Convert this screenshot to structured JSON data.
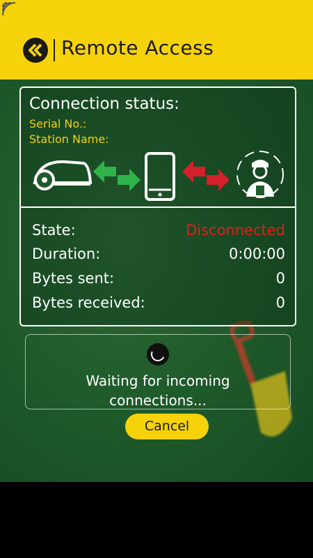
{
  "header": {
    "title": "Remote Access"
  },
  "status": {
    "heading": "Connection status:",
    "serial_label": "Serial No.:",
    "station_label": "Station Name:",
    "rows": [
      {
        "label": "State:",
        "value": "Disconnected"
      },
      {
        "label": "Duration:",
        "value": "0:00:00"
      },
      {
        "label": "Bytes sent:",
        "value": "0"
      },
      {
        "label": "Bytes received:",
        "value": "0"
      }
    ]
  },
  "waiting": {
    "line1": "Waiting for incoming",
    "line2": "connections..."
  },
  "cancel_label": "Cancel",
  "colors": {
    "header": "#f5d20a",
    "disconnected": "#e0201a",
    "green_arrow": "#2fb34a",
    "red_arrow": "#d4202a"
  }
}
